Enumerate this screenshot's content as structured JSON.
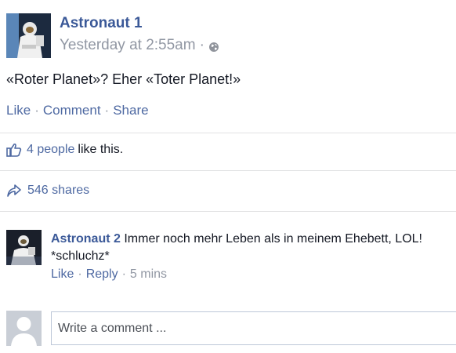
{
  "post": {
    "author": "Astronaut 1",
    "timestamp": "Yesterday at 2:55am",
    "meta_separator": "·",
    "privacy_icon": "globe-icon",
    "text": "«Roter Planet»? Eher «Toter Planet!»",
    "actions": {
      "like": "Like",
      "comment": "Comment",
      "share": "Share",
      "separator": "·"
    },
    "likes": {
      "icon": "thumbs-up-icon",
      "count": "4 people",
      "suffix": "like this."
    },
    "shares": {
      "icon": "share-arrow-icon",
      "count": "546 shares"
    }
  },
  "comment": {
    "author": "Astronaut 2",
    "text": "Immer noch mehr Leben als in meinem Ehebett, LOL! *schluchz*",
    "actions": {
      "like": "Like",
      "reply": "Reply",
      "time": "5 mins",
      "separator": "·"
    }
  },
  "composer": {
    "placeholder": "Write a comment ..."
  },
  "colors": {
    "name_blue": "#3b5998",
    "link_blue": "#4e69a2",
    "meta_gray": "#9197a3",
    "divider": "#e1e2e3"
  }
}
